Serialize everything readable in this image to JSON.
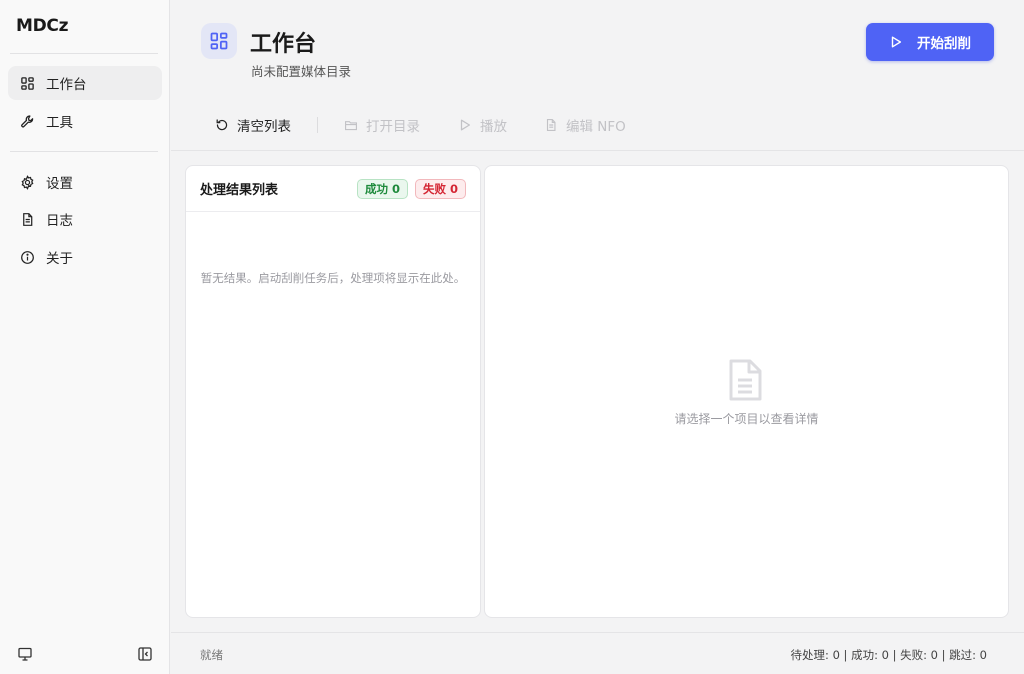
{
  "app": {
    "name": "MDCz",
    "accent": "#4f63f5"
  },
  "sidebar": {
    "items": [
      {
        "label": "工作台",
        "icon": "dashboard-icon",
        "active": true
      },
      {
        "label": "工具",
        "icon": "wrench-icon",
        "active": false
      },
      {
        "label": "设置",
        "icon": "gear-icon",
        "active": false
      },
      {
        "label": "日志",
        "icon": "document-icon",
        "active": false
      },
      {
        "label": "关于",
        "icon": "info-icon",
        "active": false
      }
    ],
    "bottom_icons": [
      "monitor-icon",
      "collapse-sidebar-icon"
    ]
  },
  "header": {
    "title": "工作台",
    "subtitle": "尚未配置媒体目录",
    "icon": "dashboard-icon",
    "start_button": "开始刮削"
  },
  "toolbar": {
    "clear": "清空列表",
    "open_dir": "打开目录",
    "play": "播放",
    "edit_nfo": "编辑 NFO"
  },
  "results": {
    "title": "处理结果列表",
    "success_badge": "成功 0",
    "fail_badge": "失败 0",
    "empty": "暂无结果。启动刮削任务后，处理项将显示在此处。"
  },
  "detail": {
    "hint": "请选择一个项目以查看详情",
    "icon": "file-icon"
  },
  "status": {
    "left": "就绪",
    "right": "待处理: 0 | 成功: 0 | 失败: 0 | 跳过: 0"
  }
}
